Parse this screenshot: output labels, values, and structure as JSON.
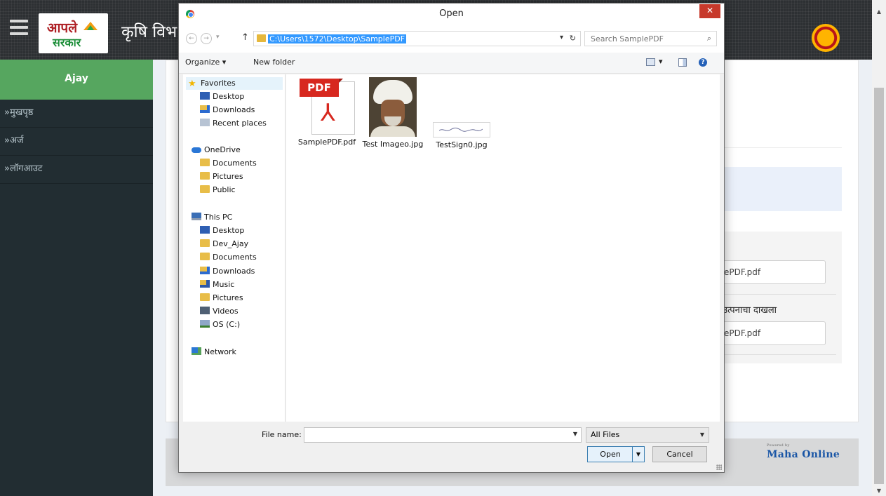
{
  "page": {
    "logo": {
      "line1": "आपले",
      "line2": "सरकार"
    },
    "site_title": "कृषि विभ",
    "user_name": "Ajay",
    "menu": [
      {
        "label": "»मुखपृष्ठ"
      },
      {
        "label": "»अर्ज"
      },
      {
        "label": "»लॉगआउट"
      }
    ],
    "file_inputs": [
      {
        "value": "ePDF.pdf"
      },
      {
        "value": "ePDF.pdf"
      }
    ],
    "field_label": "उत्पनाचा दाखला",
    "footer_logo": {
      "powered_by": "Powered by",
      "name": "Maha Online"
    }
  },
  "dialog": {
    "title": "Open",
    "close_glyph": "✕",
    "address_path": "C:\\Users\\1572\\Desktop\\SamplePDF",
    "search_placeholder": "Search SamplePDF",
    "toolbar": {
      "organize": "Organize ▾",
      "new_folder": "New folder"
    },
    "nav_tree": [
      {
        "label": "Favorites",
        "icon": "star-icon"
      },
      {
        "label": "Desktop",
        "icon": "desktop-icon"
      },
      {
        "label": "Downloads",
        "icon": "downloads-icon"
      },
      {
        "label": "Recent places",
        "icon": "recent-places-icon"
      },
      {
        "label": "OneDrive",
        "icon": "cloud-icon"
      },
      {
        "label": "Documents",
        "icon": "folder-icon"
      },
      {
        "label": "Pictures",
        "icon": "folder-icon"
      },
      {
        "label": "Public",
        "icon": "folder-icon"
      },
      {
        "label": "This PC",
        "icon": "computer-icon"
      },
      {
        "label": "Desktop",
        "icon": "desktop-icon"
      },
      {
        "label": "Dev_Ajay",
        "icon": "folder-icon"
      },
      {
        "label": "Documents",
        "icon": "folder-icon"
      },
      {
        "label": "Downloads",
        "icon": "downloads-icon"
      },
      {
        "label": "Music",
        "icon": "music-icon"
      },
      {
        "label": "Pictures",
        "icon": "folder-icon"
      },
      {
        "label": "Videos",
        "icon": "videos-icon"
      },
      {
        "label": "OS (C:)",
        "icon": "drive-icon"
      },
      {
        "label": "Network",
        "icon": "network-icon"
      }
    ],
    "files": [
      {
        "name": "SamplePDF.pdf",
        "thumb_tag": "PDF",
        "icon": "pdf-file-icon"
      },
      {
        "name": "Test Imageo.jpg",
        "icon": "photo-thumbnail"
      },
      {
        "name": "TestSign0.jpg",
        "icon": "signature-thumbnail"
      }
    ],
    "file_name_label": "File name:",
    "file_name_value": "",
    "file_type": "All Files",
    "open_label": "Open",
    "cancel_label": "Cancel"
  }
}
